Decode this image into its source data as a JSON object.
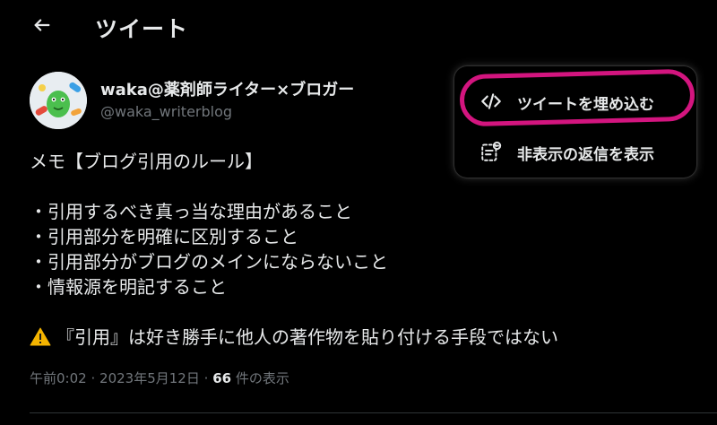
{
  "header": {
    "back_icon": "arrow-left-icon",
    "title": "ツイート"
  },
  "author": {
    "avatar_icon": "avatar-image",
    "name": "waka@薬剤師ライター×ブロガー",
    "handle": "@waka_writerblog"
  },
  "tweet": {
    "lines": [
      "メモ【ブログ引用のルール】",
      "・引用するべき真っ当な理由があること",
      "・引用部分を明確に区別すること",
      "・引用部分がブログのメインにならないこと",
      "・情報源を明記すること"
    ],
    "warning_icon": "warning-icon",
    "warning_text": "『引用』は好き勝手に他人の著作物を貼り付ける手段ではない"
  },
  "meta": {
    "time": "午前0:02",
    "separator": "·",
    "date": "2023年5月12日",
    "views_count": "66",
    "views_label": "件の表示"
  },
  "menu": {
    "embed": {
      "icon": "code-icon",
      "label": "ツイートを埋め込む"
    },
    "hidden_replies": {
      "icon": "hidden-replies-icon",
      "label": "非表示の返信を表示"
    }
  },
  "colors": {
    "background": "#000000",
    "text_primary": "#e7e9ea",
    "text_secondary": "#71767b",
    "highlight": "#d3157f",
    "warning": "#f4b400"
  }
}
